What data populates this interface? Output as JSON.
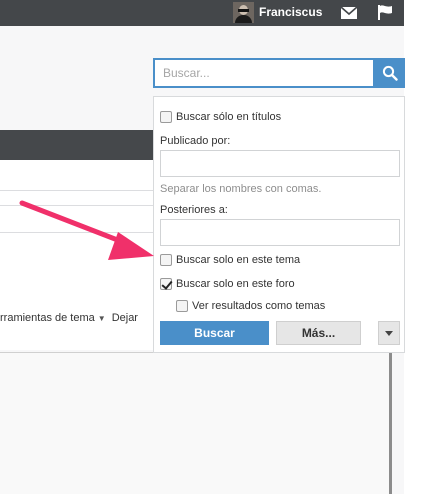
{
  "topbar": {
    "username": "Franciscus",
    "icons": [
      "avatar",
      "mail-icon",
      "flag-icon"
    ]
  },
  "page": {
    "toolbar_text": "rramientas de tema",
    "toolbar_next": "Dejar"
  },
  "search": {
    "placeholder": "Buscar...",
    "value": "",
    "button_icon": "search-icon",
    "accent": "#4a8fc9"
  },
  "panel": {
    "titles_only_label": "Buscar sólo en títulos",
    "titles_only_checked": false,
    "posted_by_label": "Publicado por:",
    "posted_by_value": "",
    "separator_hint": "Separar los nombres con comas.",
    "after_label": "Posteriores a:",
    "after_value": "",
    "this_thread_label": "Buscar solo en este tema",
    "this_thread_checked": false,
    "this_forum_label": "Buscar solo en este foro",
    "this_forum_checked": true,
    "as_threads_label": "Ver resultados como temas",
    "as_threads_checked": false,
    "search_button": "Buscar",
    "more_button": "Más...",
    "annotation_color": "#f0306a"
  }
}
